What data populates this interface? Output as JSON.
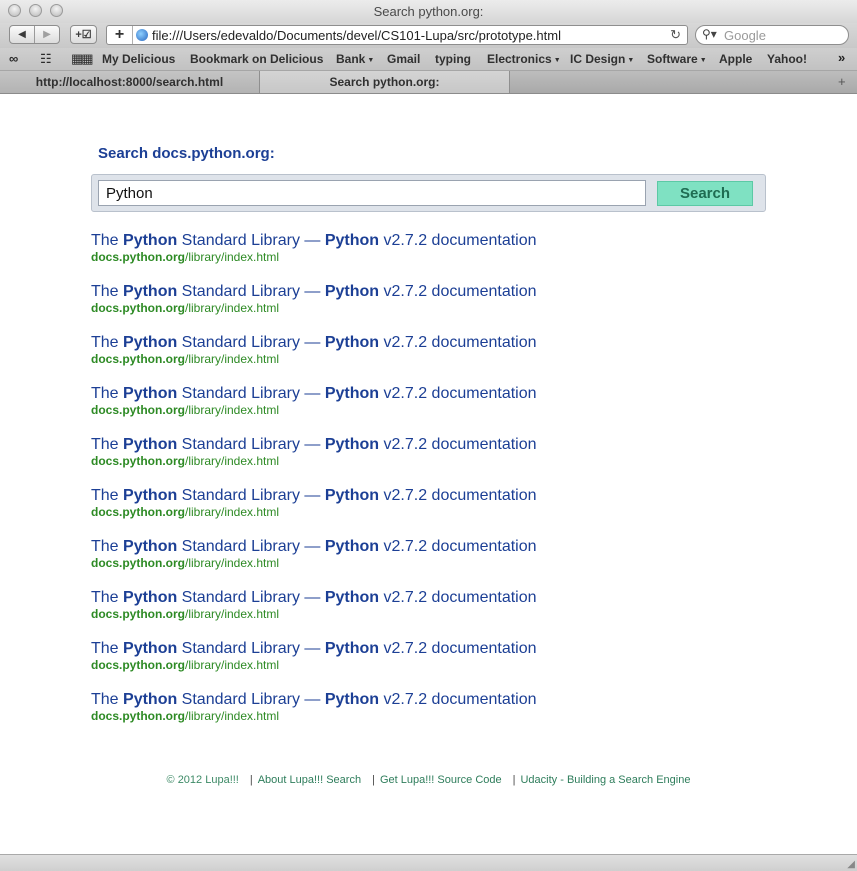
{
  "window": {
    "title": "Search python.org:"
  },
  "toolbar": {
    "url": "file:///Users/edevaldo/Documents/devel/CS101-Lupa/src/prototype.html",
    "search_placeholder": "Google"
  },
  "bookmarks": {
    "items": [
      {
        "label": "My Delicious",
        "menu": false
      },
      {
        "label": "Bookmark on Delicious",
        "menu": false
      },
      {
        "label": "Bank",
        "menu": true
      },
      {
        "label": "Gmail",
        "menu": false
      },
      {
        "label": "typing",
        "menu": false
      },
      {
        "label": "Electronics",
        "menu": true
      },
      {
        "label": "IC Design",
        "menu": true
      },
      {
        "label": "Software",
        "menu": true
      },
      {
        "label": "Apple",
        "menu": false
      },
      {
        "label": "Yahoo!",
        "menu": false
      }
    ]
  },
  "tabs": [
    {
      "label": "http://localhost:8000/search.html",
      "active": false
    },
    {
      "label": "Search python.org:",
      "active": true
    }
  ],
  "search": {
    "heading": "Search docs.python.org:",
    "query": "Python",
    "button_label": "Search"
  },
  "results": [
    {
      "t1": "The ",
      "t2": "Python",
      "t3": " Standard Library — ",
      "t4": "Python",
      "t5": " v2.7.2 documentation",
      "domain": "docs.python.org",
      "path": "/library/index.html"
    },
    {
      "t1": "The ",
      "t2": "Python",
      "t3": " Standard Library — ",
      "t4": "Python",
      "t5": " v2.7.2 documentation",
      "domain": "docs.python.org",
      "path": "/library/index.html"
    },
    {
      "t1": "The ",
      "t2": "Python",
      "t3": " Standard Library — ",
      "t4": "Python",
      "t5": " v2.7.2 documentation",
      "domain": "docs.python.org",
      "path": "/library/index.html"
    },
    {
      "t1": "The ",
      "t2": "Python",
      "t3": " Standard Library — ",
      "t4": "Python",
      "t5": " v2.7.2 documentation",
      "domain": "docs.python.org",
      "path": "/library/index.html"
    },
    {
      "t1": "The ",
      "t2": "Python",
      "t3": " Standard Library — ",
      "t4": "Python",
      "t5": " v2.7.2 documentation",
      "domain": "docs.python.org",
      "path": "/library/index.html"
    },
    {
      "t1": "The ",
      "t2": "Python",
      "t3": " Standard Library — ",
      "t4": "Python",
      "t5": " v2.7.2 documentation",
      "domain": "docs.python.org",
      "path": "/library/index.html"
    },
    {
      "t1": "The ",
      "t2": "Python",
      "t3": " Standard Library — ",
      "t4": "Python",
      "t5": " v2.7.2 documentation",
      "domain": "docs.python.org",
      "path": "/library/index.html"
    },
    {
      "t1": "The ",
      "t2": "Python",
      "t3": " Standard Library — ",
      "t4": "Python",
      "t5": " v2.7.2 documentation",
      "domain": "docs.python.org",
      "path": "/library/index.html"
    },
    {
      "t1": "The ",
      "t2": "Python",
      "t3": " Standard Library — ",
      "t4": "Python",
      "t5": " v2.7.2 documentation",
      "domain": "docs.python.org",
      "path": "/library/index.html"
    },
    {
      "t1": "The ",
      "t2": "Python",
      "t3": " Standard Library — ",
      "t4": "Python",
      "t5": " v2.7.2 documentation",
      "domain": "docs.python.org",
      "path": "/library/index.html"
    }
  ],
  "footer": {
    "copyright": "© 2012 Lupa!!!",
    "sep": "|",
    "about": "About Lupa!!! Search",
    "source": "Get Lupa!!! Source Code",
    "udacity": "Udacity - Building a Search Engine"
  },
  "colors": {
    "link_blue": "#1c3f95",
    "url_green": "#2d8a24",
    "button_green": "#7fe1c2",
    "footer_green": "#2e7d5b"
  },
  "icons": [
    "back-icon",
    "forward-icon",
    "add-bookmark-icon",
    "plus-icon",
    "globe-icon",
    "reload-icon",
    "magnifier-icon",
    "reading-list-icon",
    "bookmarks-book-icon",
    "top-sites-grid-icon",
    "more-bookmarks-icon",
    "new-tab-icon",
    "resize-grip-icon"
  ]
}
